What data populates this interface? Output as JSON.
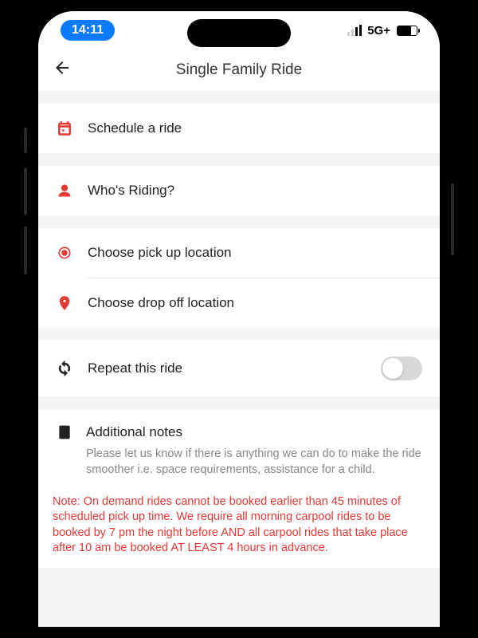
{
  "status_bar": {
    "time": "14:11",
    "network": "5G+"
  },
  "header": {
    "title": "Single Family Ride"
  },
  "rows": {
    "schedule": "Schedule a ride",
    "who": "Who's Riding?",
    "pickup": "Choose pick up location",
    "dropoff": "Choose drop off location",
    "repeat": "Repeat this ride",
    "notes_title": "Additional notes",
    "notes_desc": "Please let us know if there is anything we can do to make the ride smoother i.e. space requirements, assistance for a child."
  },
  "warning": "Note: On demand rides cannot be booked earlier than 45 minutes of scheduled pick up time. We require all morning carpool rides to be booked by 7 pm the night before AND all carpool rides that take place after 10 am be booked AT LEAST 4 hours in advance."
}
